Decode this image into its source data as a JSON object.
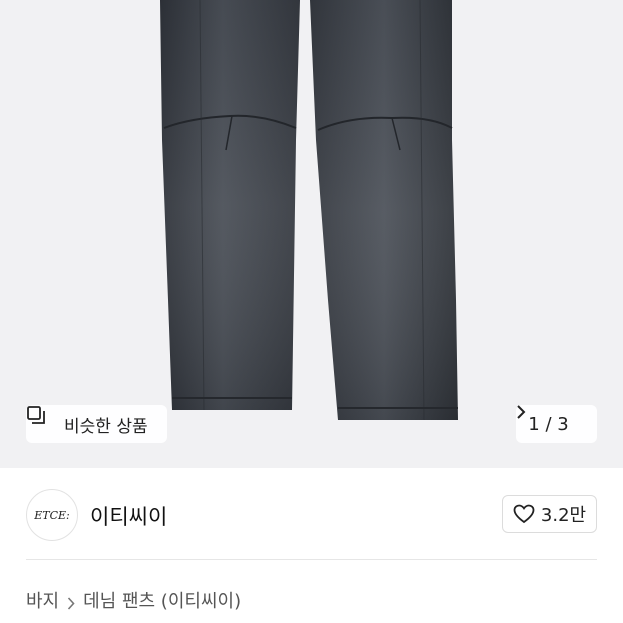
{
  "hero": {
    "similar_label": "비슷한 상품",
    "pager_text": "1 / 3"
  },
  "brand": {
    "logo_text": "ETCE:",
    "name": "이티씨이",
    "like_count": "3.2만"
  },
  "breadcrumb": {
    "category": "바지",
    "subcategory": "데님 팬츠 (이티씨이)"
  },
  "colors": {
    "image_background": "#f1f1f3",
    "denim": "#3f434a"
  },
  "icons": {
    "similar": "similar-items-icon",
    "pager": "chevron-right-icon",
    "like": "heart-icon",
    "breadcrumb_sep": "chevron-right-icon"
  }
}
